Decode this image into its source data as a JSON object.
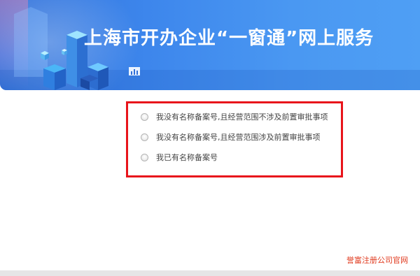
{
  "banner": {
    "title": "上海市开办企业“一窗通”网上服务"
  },
  "options": [
    {
      "label": "我没有名称备案号,且经营范围不涉及前置审批事项",
      "selected": false
    },
    {
      "label": "我没有名称备案号,且经营范围涉及前置审批事项",
      "selected": false
    },
    {
      "label": "我已有名称备案号",
      "selected": false
    }
  ],
  "watermark": "誉富注册公司官网",
  "colors": {
    "banner_blue": "#3d86ec",
    "highlight_border": "#e8141b",
    "watermark": "#e03a1e"
  }
}
